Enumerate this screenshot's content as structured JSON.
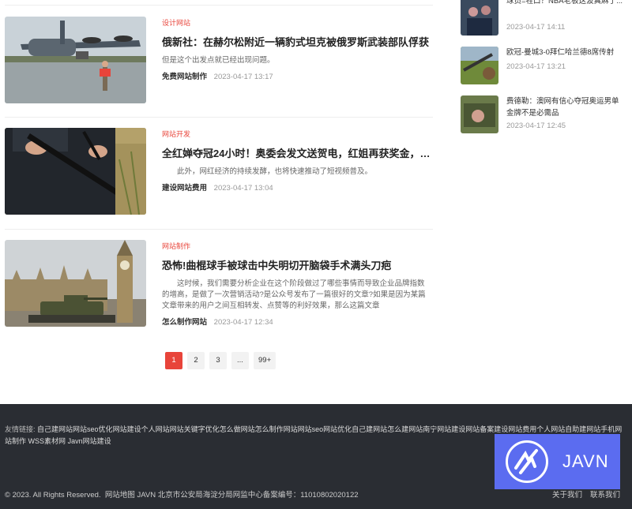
{
  "articles": [
    {
      "category": "设计网站",
      "title": "俄新社：在赫尔松附近一辆豹式坦克被俄罗斯武装部队俘获",
      "desc": "但是这个出发点就已经出现问题。",
      "author": "免费网站制作",
      "time": "2023-04-17 13:17"
    },
    {
      "category": "网站开发",
      "title": "全红婵夺冠24小时！奥委会发文送贺电，红姐再获奖金，中...",
      "desc": "此外，网红经济的持续发酵，也将快速推动了短视频普及。",
      "author": "建设网站费用",
      "time": "2023-04-17 13:04"
    },
    {
      "category": "网站制作",
      "title": "恐怖!曲棍球手被球击中失明切开脑袋手术满头刀疤",
      "desc": "这时候，我们需要分析企业在这个阶段做过了哪些事情而导致企业品牌指数的增高，是做了一次营销活动?是公众号发布了一篇很好的文章?如果是因为某篇文章带来的用户之间互相转发、点赞等的利好效果，那么这篇文章",
      "author": "怎么制作网站",
      "time": "2023-04-17 12:34"
    }
  ],
  "pagination": [
    "1",
    "2",
    "3",
    "...",
    "99+"
  ],
  "sidebar": [
    {
      "title": "球员=牲口？NBA老板这波真麻了...",
      "time": "2023-04-17 14:11"
    },
    {
      "title": "欧冠-曼城3-0拜仁哈兰德8席传射",
      "time": "2023-04-17 13:21"
    },
    {
      "title": "费德勒：澳网有信心夺冠奥运男单金牌不是必需品",
      "time": "2023-04-17 12:45"
    }
  ],
  "footer": {
    "links_label": "友情链接:",
    "links": [
      "自己建网站",
      "网站seo优化",
      "网站建设",
      "个人网站",
      "网站关键字优化",
      "怎么做网站",
      "怎么制作网站",
      "网站seo",
      "网站优化",
      "自己建网站",
      "怎么建网站",
      "南宁网站建设",
      "网站备案",
      "建设网站费用",
      "个人网站",
      "自助建网站",
      "手机网站制作",
      "WSS素材网",
      "Javn网站建设"
    ],
    "copyright": "© 2023. All Rights Reserved.",
    "sitemap": "网站地图",
    "icp": "JAVN 北京市公安局海淀分局网监中心备案编号：11010802020122",
    "about": "关于我们",
    "contact": "联系我们",
    "logo_text": "JAVN"
  },
  "colors": {
    "accent": "#e8443a",
    "footer_bg": "#2a2d33",
    "logo_bg": "#5b6cf0"
  }
}
